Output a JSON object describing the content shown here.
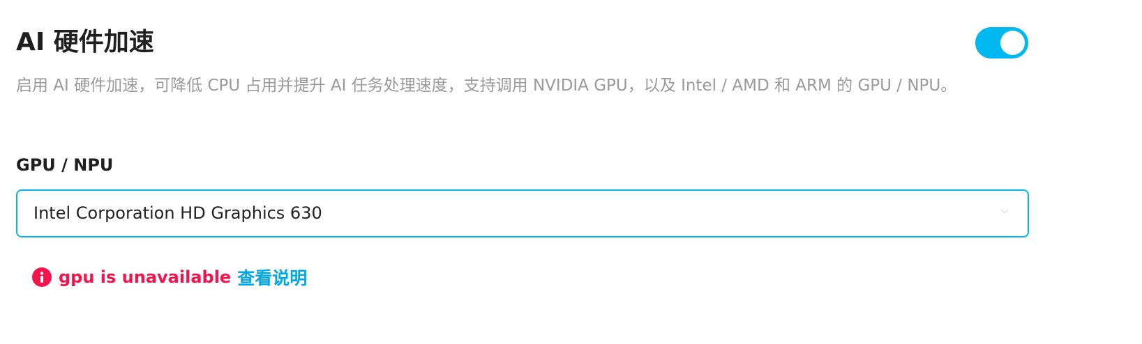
{
  "setting": {
    "title": "AI 硬件加速",
    "enabled": true,
    "description": "启用 AI 硬件加速，可降低 CPU 占用并提升 AI 任务处理速度，支持调用 NVIDIA GPU，以及 Intel / AMD 和 ARM 的 GPU / NPU。",
    "accent_color": "#00b8f0"
  },
  "gpu_field": {
    "label": "GPU / NPU",
    "selected_value": "Intel Corporation HD Graphics 630"
  },
  "error": {
    "icon": "info-circle-icon",
    "message": "gpu is unavailable",
    "link_label": "查看说明",
    "error_color": "#f5134c",
    "link_color": "#00a9e6"
  }
}
